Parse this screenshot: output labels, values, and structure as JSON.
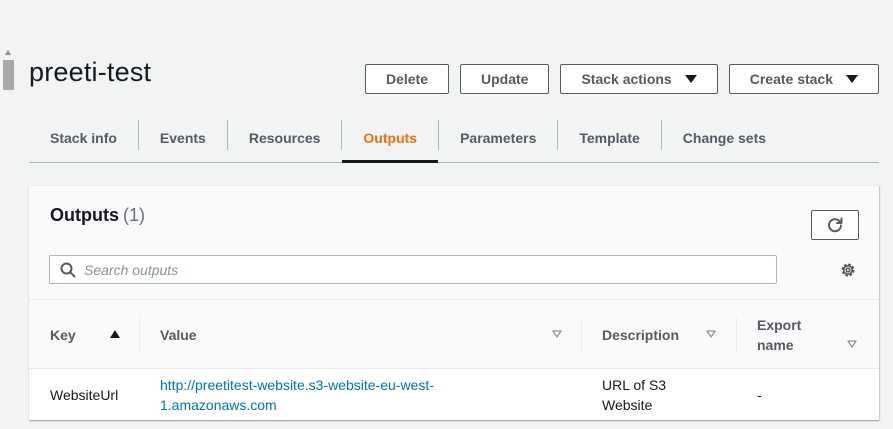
{
  "page": {
    "title": "preeti-test"
  },
  "actions": {
    "delete": "Delete",
    "update": "Update",
    "stack_actions": "Stack actions",
    "create_stack": "Create stack"
  },
  "tabs": [
    {
      "label": "Stack info",
      "active": false
    },
    {
      "label": "Events",
      "active": false
    },
    {
      "label": "Resources",
      "active": false
    },
    {
      "label": "Outputs",
      "active": true
    },
    {
      "label": "Parameters",
      "active": false
    },
    {
      "label": "Template",
      "active": false
    },
    {
      "label": "Change sets",
      "active": false
    }
  ],
  "outputs": {
    "title": "Outputs",
    "count": "(1)",
    "search_placeholder": "Search outputs",
    "refresh_icon": "refresh-icon",
    "settings_icon": "gear-icon",
    "columns": {
      "key": "Key",
      "value": "Value",
      "description": "Description",
      "export_line1": "Export",
      "export_line2": "name"
    },
    "rows": [
      {
        "key": "WebsiteUrl",
        "value_line1": "http://preetitest-website.s3-website-eu-west-",
        "value_line2": "1.amazonaws.com",
        "description_line1": "URL of S3",
        "description_line2": "Website",
        "export_name": "-"
      }
    ]
  },
  "colors": {
    "active_tab": "#ec7211",
    "link": "#0073bb",
    "background": "#f2f3f3"
  }
}
